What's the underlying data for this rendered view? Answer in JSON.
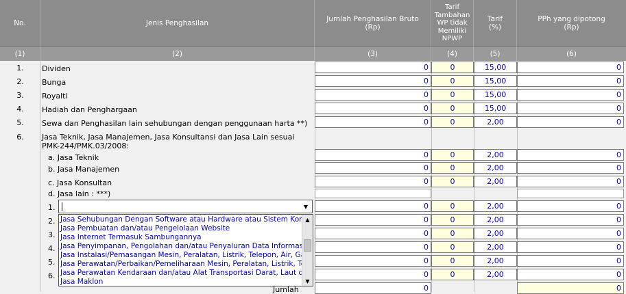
{
  "header": {
    "col_no": "No.",
    "col_jenis": "Jenis Penghasilan",
    "col_bruto": "Jumlah Penghasilan Bruto\n(Rp)",
    "col_tambahan": "Tarif\nTambahan\nWP tidak\nMemiliki\nNPWP",
    "col_tarif": "Tarif\n(%)",
    "col_pph": "PPh yang dipotong\n(Rp)"
  },
  "colnums": [
    "(1)",
    "(2)",
    "(3)",
    "(4)",
    "(5)",
    "(6)"
  ],
  "rows": [
    {
      "no": "1.",
      "label": "Dividen",
      "bruto": "0",
      "tambahan": "0",
      "tarif": "15,00",
      "pph": "0"
    },
    {
      "no": "2.",
      "label": "Bunga",
      "bruto": "0",
      "tambahan": "0",
      "tarif": "15,00",
      "pph": "0"
    },
    {
      "no": "3.",
      "label": "Royalti",
      "bruto": "0",
      "tambahan": "0",
      "tarif": "15,00",
      "pph": "0"
    },
    {
      "no": "4.",
      "label": "Hadiah dan Penghargaan",
      "bruto": "0",
      "tambahan": "0",
      "tarif": "15,00",
      "pph": "0"
    },
    {
      "no": "5.",
      "label": "Sewa dan Penghasilan lain sehubungan dengan penggunaan harta **)",
      "bruto": "0",
      "tambahan": "0",
      "tarif": "2,00",
      "pph": "0"
    }
  ],
  "row6": {
    "no": "6.",
    "label_line1": "Jasa Teknik, Jasa Manajemen,  Jasa Konsultansi dan Jasa Lain sesuai",
    "label_line2": "PMK-244/PMK.03/2008:"
  },
  "subrows": [
    {
      "label": "a. Jasa Teknik",
      "bruto": "0",
      "tambahan": "0",
      "tarif": "2,00",
      "pph": "0"
    },
    {
      "label": "b. Jasa Manajemen",
      "bruto": "0",
      "tambahan": "0",
      "tarif": "2,00",
      "pph": "0"
    },
    {
      "label": "c. Jasa Konsultan",
      "bruto": "0",
      "tambahan": "0",
      "tarif": "2,00",
      "pph": "0"
    }
  ],
  "jasa_lain_label": "d. Jasa lain : ***)",
  "lain_rows": [
    {
      "no": "1.",
      "bruto": "0",
      "tambahan": "0",
      "tarif": "2,00",
      "pph": "0"
    },
    {
      "no": "2.",
      "bruto": "0",
      "tambahan": "0",
      "tarif": "2,00",
      "pph": "0"
    },
    {
      "no": "3.",
      "bruto": "0",
      "tambahan": "0",
      "tarif": "2,00",
      "pph": "0"
    },
    {
      "no": "4.",
      "bruto": "0",
      "tambahan": "0",
      "tarif": "2,00",
      "pph": "0"
    },
    {
      "no": "5.",
      "bruto": "0",
      "tambahan": "0",
      "tarif": "2,00",
      "pph": "0"
    },
    {
      "no": "6.",
      "bruto": "0",
      "tambahan": "0",
      "tarif": "2,00",
      "pph": "0"
    }
  ],
  "combo": {
    "value": ""
  },
  "dropdown_items": [
    "Jasa Sehubungan Dengan Software atau Hardware atau Sistem Komputer",
    "Jasa Pembuatan dan/atau Pengelolaan Website",
    "Jasa Internet Termasuk Sambungannya",
    "Jasa Penyimpanan, Pengolahan dan/atau Penyaluran Data Informasi, dan",
    "Jasa Instalasi/Pemasangan Mesin, Peralatan, Listrik, Telepon, Air, Gas, AC",
    "Jasa Perawatan/Perbaikan/Pemeliharaan Mesin, Peralatan, Listrik, Telepo",
    "Jasa Perawatan Kendaraan dan/atau Alat Transportasi Darat, Laut dan U",
    "Jasa Maklon"
  ],
  "jumlah": {
    "label": "Jumlah",
    "bruto": "0",
    "pph": "0"
  },
  "colors": {
    "header_bg": "#8c8c8c",
    "value_text": "#0000c0",
    "tambahan_bg": "#ffffe0"
  }
}
